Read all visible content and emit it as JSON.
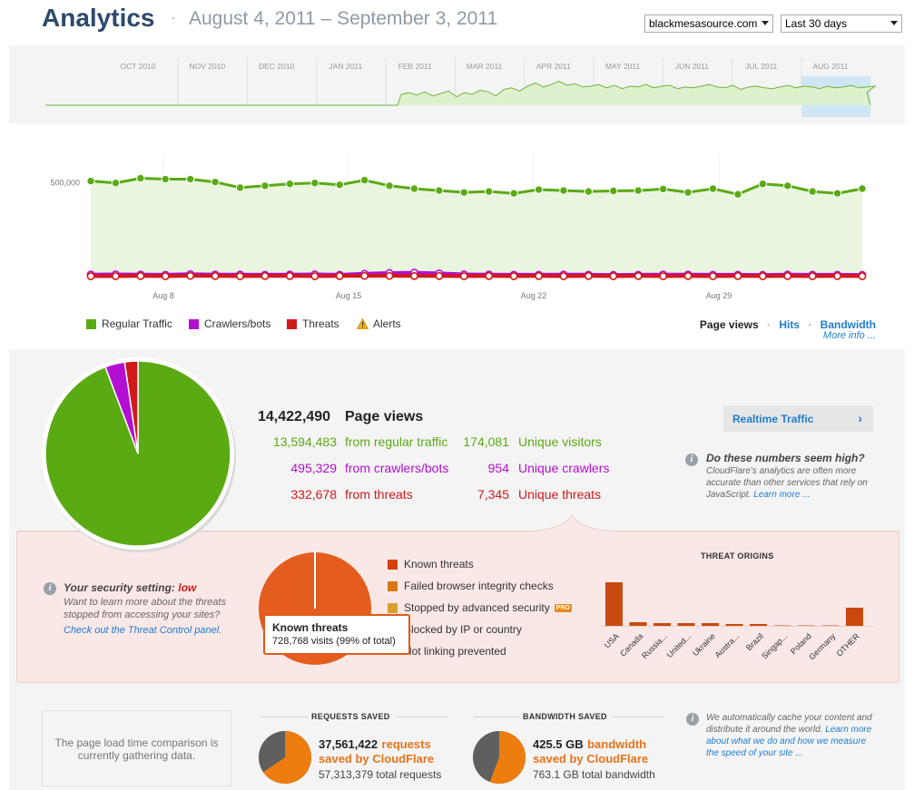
{
  "header": {
    "title": "Analytics",
    "separator": "·",
    "date_range": "August 4, 2011 – September 3, 2011",
    "site_select": "blackmesasource.com",
    "period_select": "Last 30 days"
  },
  "overview": {
    "months": [
      "OCT 2010",
      "NOV 2010",
      "DEC 2010",
      "JAN 2011",
      "FEB 2011",
      "MAR 2011",
      "APR 2011",
      "MAY 2011",
      "JUN 2011",
      "JUL 2011",
      "AUG 2011"
    ]
  },
  "chart_data": {
    "type": "line",
    "title": "",
    "xlabel": "",
    "ylabel": "",
    "x_tick_labels": [
      "Aug 8",
      "Aug 15",
      "Aug 22",
      "Aug 29"
    ],
    "y_tick_labels": [
      "500,000"
    ],
    "series": [
      {
        "name": "Regular Traffic",
        "color": "#5aaa14",
        "values": [
          510000,
          500000,
          525000,
          520000,
          520000,
          505000,
          475000,
          485000,
          495000,
          500000,
          490000,
          515000,
          485000,
          470000,
          460000,
          450000,
          455000,
          445000,
          465000,
          460000,
          455000,
          458000,
          460000,
          468000,
          450000,
          470000,
          440000,
          495000,
          485000,
          455000,
          445000,
          470000
        ]
      },
      {
        "name": "Crawlers/bots",
        "color": "#b30fd0",
        "values": [
          16000,
          17000,
          16000,
          15000,
          18000,
          16000,
          16000,
          15000,
          16000,
          17000,
          15000,
          20000,
          24000,
          26000,
          22000,
          17000,
          16000,
          15000,
          15000,
          16000,
          15000,
          14000,
          15000,
          16000,
          16000,
          15000,
          15000,
          14000,
          16000,
          15000,
          15000,
          14000
        ]
      },
      {
        "name": "Threats",
        "color": "#d11a1a",
        "values": [
          7000,
          7000,
          8000,
          7000,
          9000,
          8000,
          7000,
          8000,
          8000,
          7000,
          8000,
          9000,
          9000,
          8000,
          8000,
          7000,
          8000,
          7000,
          8000,
          7000,
          8000,
          7000,
          8000,
          7000,
          8000,
          7000,
          8000,
          7000,
          8000,
          7000,
          8000,
          7000
        ]
      }
    ]
  },
  "legend": {
    "regular": "Regular Traffic",
    "crawlers": "Crawlers/bots",
    "threats": "Threats",
    "alerts": "Alerts"
  },
  "view_links": {
    "page_views": "Page views",
    "sep": "·",
    "hits": "Hits",
    "bandwidth": "Bandwidth",
    "more_info": "More info ..."
  },
  "stats": {
    "page_views_num": "14,422,490",
    "page_views_label": "Page views",
    "regular_num": "13,594,483",
    "regular_label": "from regular traffic",
    "crawlers_num": "495,329",
    "crawlers_label": "from crawlers/bots",
    "threats_num": "332,678",
    "threats_label": "from threats",
    "unique_visitors_num": "174,081",
    "unique_visitors_label": "Unique visitors",
    "unique_crawlers_num": "954",
    "unique_crawlers_label": "Unique crawlers",
    "unique_threats_num": "7,345",
    "unique_threats_label": "Unique threats",
    "pie_fractions": {
      "regular": 0.9426,
      "crawlers": 0.0343,
      "threats": 0.0231
    }
  },
  "realtime": {
    "label": "Realtime Traffic",
    "chevron": "›"
  },
  "numbers_note": {
    "title": "Do these numbers seem high?",
    "text": "CloudFlare's analytics are often more accurate than other services that rely on JavaScript.",
    "link": "Learn more ..."
  },
  "security": {
    "title_prefix": "Your security setting:",
    "level": "low",
    "text": "Want to learn more about the threats stopped from accessing your sites?",
    "link": "Check out the Threat Control panel."
  },
  "threat_legend": [
    {
      "label": "Known threats",
      "color": "#d5400c"
    },
    {
      "label": "Failed browser integrity checks",
      "color": "#d87812"
    },
    {
      "label": "Stopped by advanced security",
      "color": "#d8a030",
      "badge": "PRO"
    },
    {
      "label": "Blocked by IP or country",
      "color": "#efe3b0"
    },
    {
      "label": "Hot linking prevented",
      "color": "#f3efd8"
    }
  ],
  "tooltip": {
    "title": "Known threats",
    "text": "728,768 visits (99% of total)"
  },
  "threat_pie_fraction": 0.99,
  "threat_origins": {
    "title": "THREAT ORIGINS",
    "categories": [
      "USA",
      "Canada",
      "Russia...",
      "United...",
      "Ukraine",
      "Austra...",
      "Brazil",
      "Singap...",
      "Poland",
      "Germany",
      "OTHER"
    ],
    "values": [
      48,
      4,
      3,
      3,
      3,
      2,
      2,
      1,
      1,
      1,
      20
    ]
  },
  "bottom": {
    "load_time_text": "The page load time comparison is currently gathering data.",
    "requests_head": "REQUESTS SAVED",
    "requests_num": "37,561,422",
    "requests_word": "requests",
    "requests_saved": "saved by CloudFlare",
    "requests_total": "57,313,379 total requests",
    "requests_fraction": 0.655,
    "bandwidth_head": "BANDWIDTH SAVED",
    "bandwidth_num": "425.5 GB",
    "bandwidth_word": "bandwidth",
    "bandwidth_saved": "saved by CloudFlare",
    "bandwidth_total": "763.1 GB total bandwidth",
    "bandwidth_fraction": 0.558,
    "cache_text": "We automatically cache your content and distribute it around the world.",
    "cache_link": "Learn more about what we do and how we measure the speed of your site ..."
  },
  "colors": {
    "green": "#5aaa14",
    "purple": "#b30fd0",
    "red": "#d11a1a",
    "orange": "#e8731a",
    "link": "#1f7ed0",
    "title": "#2c4a6b"
  }
}
